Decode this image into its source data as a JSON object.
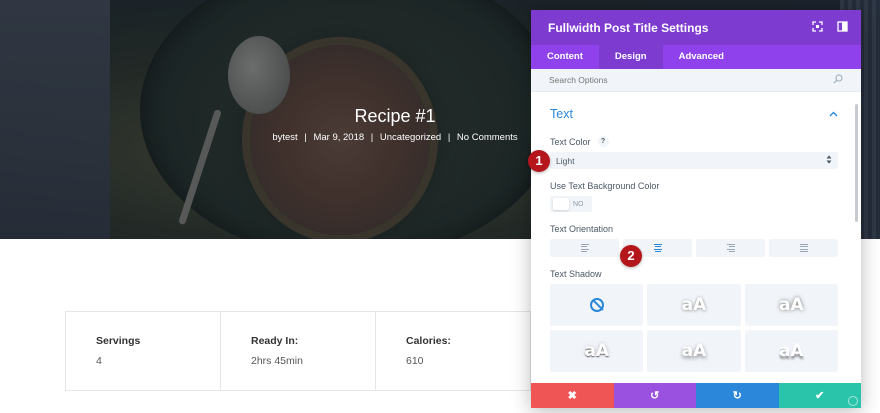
{
  "hero": {
    "title": "Recipe #1",
    "meta": {
      "author": "bytest",
      "date": "Mar 9, 2018",
      "category": "Uncategorized",
      "comments": "No Comments",
      "separator": "|"
    }
  },
  "cards": [
    {
      "label": "Servings",
      "value": "4"
    },
    {
      "label": "Ready In:",
      "value": "2hrs 45min"
    },
    {
      "label": "Calories:",
      "value": "610"
    }
  ],
  "panel": {
    "title": "Fullwidth Post Title Settings",
    "tabs": [
      {
        "label": "Content",
        "active": false
      },
      {
        "label": "Design",
        "active": true
      },
      {
        "label": "Advanced",
        "active": false
      }
    ],
    "search": {
      "placeholder": "Search Options"
    },
    "section": {
      "title": "Text"
    },
    "fields": {
      "text_color": {
        "label": "Text Color",
        "help": "?",
        "value": "Light"
      },
      "text_bg": {
        "label": "Use Text Background Color",
        "toggle_text": "NO"
      },
      "text_orientation": {
        "label": "Text Orientation",
        "options": [
          "left",
          "center",
          "right",
          "justified"
        ],
        "selected": "center"
      },
      "text_shadow": {
        "label": "Text Shadow",
        "preview_text": "aA",
        "options": [
          "none",
          "shadow-1",
          "shadow-2",
          "shadow-3",
          "shadow-4",
          "shadow-5"
        ],
        "selected": "none"
      }
    },
    "footer": {
      "cancel_icon": "✖",
      "undo_icon": "↺",
      "redo_icon": "↻",
      "save_icon": "✔"
    }
  },
  "badges": [
    "1",
    "2"
  ],
  "colors": {
    "header": "#7e3bd0",
    "tabs": "#8f42ec",
    "accent": "#2b87da",
    "cancel": "#ef5555",
    "undo": "#9b51e0",
    "redo": "#2b87da",
    "save": "#29c4a9",
    "badge": "#b5161c"
  }
}
